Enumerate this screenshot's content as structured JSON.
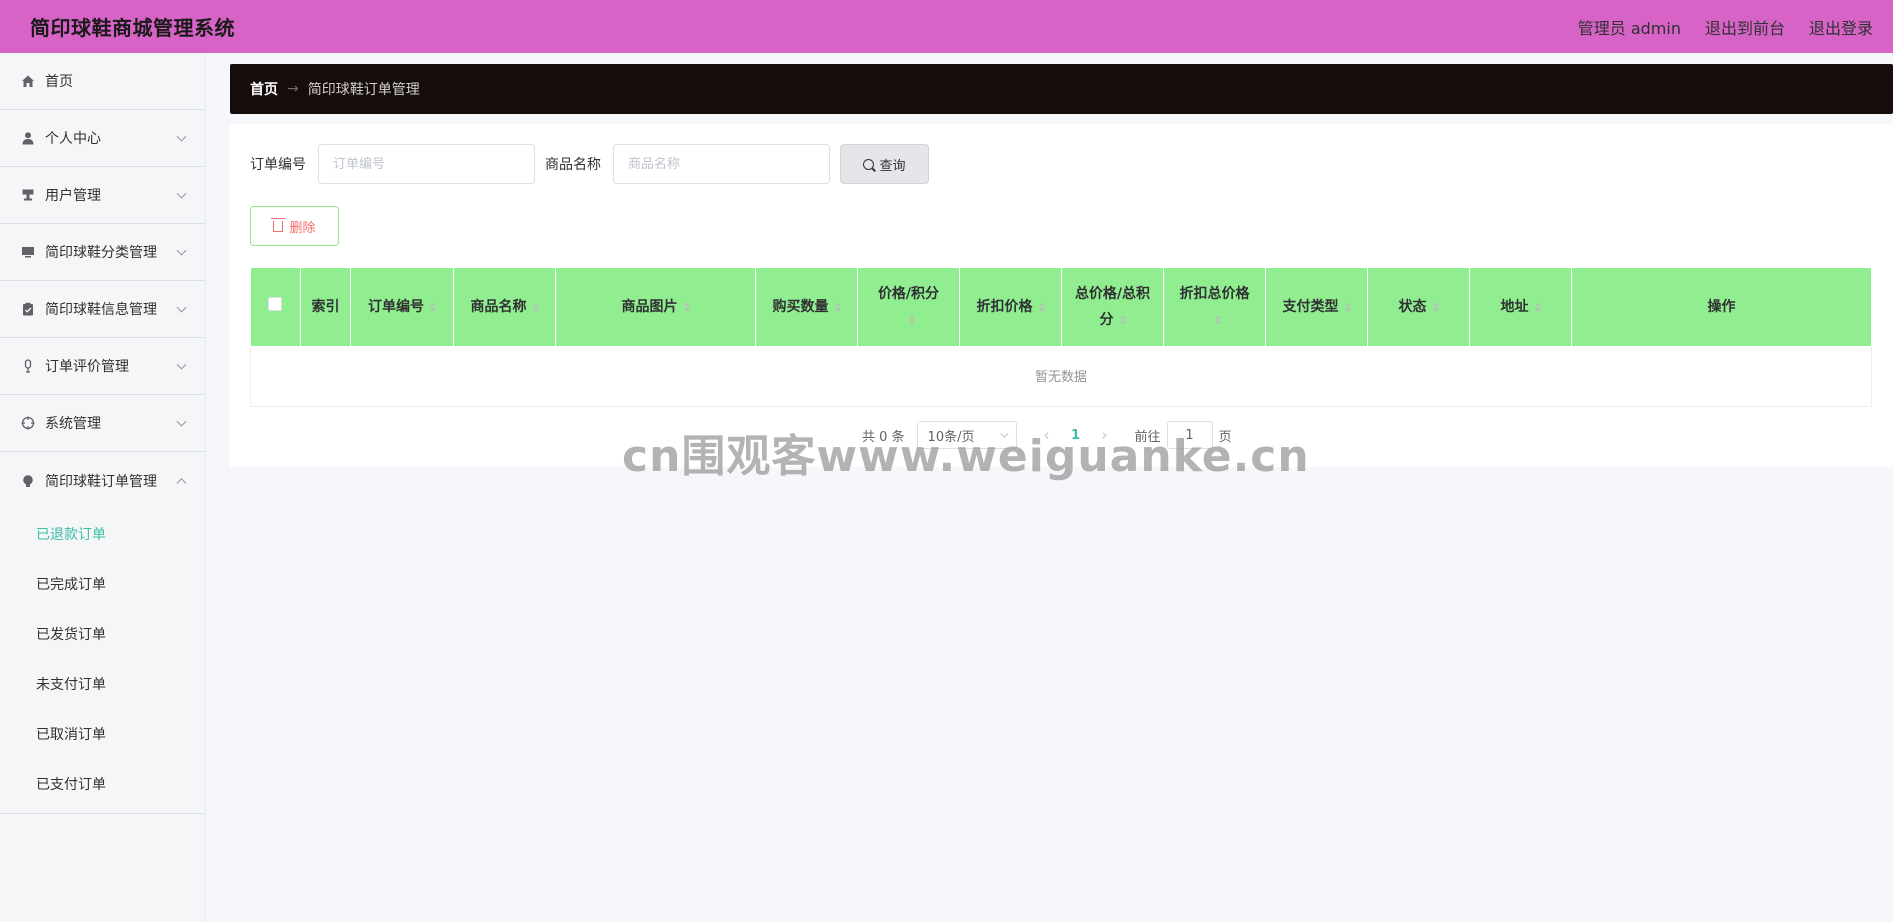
{
  "header": {
    "title": "简印球鞋商城管理系统",
    "admin_label": "管理员 admin",
    "front_label": "退出到前台",
    "logout_label": "退出登录"
  },
  "sidebar": {
    "items": [
      {
        "label": "首页",
        "icon": "home-icon"
      },
      {
        "label": "个人中心",
        "icon": "user-icon"
      },
      {
        "label": "用户管理",
        "icon": "stamp-icon"
      },
      {
        "label": "简印球鞋分类管理",
        "icon": "monitor-icon"
      },
      {
        "label": "简印球鞋信息管理",
        "icon": "clipboard-icon"
      },
      {
        "label": "订单评价管理",
        "icon": "mic-icon"
      },
      {
        "label": "系统管理",
        "icon": "target-icon"
      },
      {
        "label": "简印球鞋订单管理",
        "icon": "bulb-icon"
      }
    ],
    "subitems": [
      "已退款订单",
      "已完成订单",
      "已发货订单",
      "未支付订单",
      "已取消订单",
      "已支付订单"
    ]
  },
  "breadcrumb": {
    "home": "首页",
    "separator": "→",
    "current": "简印球鞋订单管理"
  },
  "search": {
    "order_label": "订单编号",
    "order_placeholder": "订单编号",
    "product_label": "商品名称",
    "product_placeholder": "商品名称",
    "query_label": "查询"
  },
  "actions": {
    "delete_label": "删除"
  },
  "table": {
    "columns": [
      "索引",
      "订单编号",
      "商品名称",
      "商品图片",
      "购买数量",
      "价格/积分",
      "折扣价格",
      "总价格/总积分",
      "折扣总价格",
      "支付类型",
      "状态",
      "地址",
      "操作"
    ],
    "empty_text": "暂无数据"
  },
  "pagination": {
    "total": "共 0 条",
    "page_size": "10条/页",
    "current_page": "1",
    "goto_label": "前往",
    "goto_value": "1",
    "page_suffix": "页"
  },
  "watermark": "cn围观客www.weiguanke.cn",
  "colors": {
    "header_bg": "#d763c7",
    "breadcrumb_bg": "#170c0c",
    "table_header_bg": "#90ee90",
    "accent": "#3bbfa5",
    "danger": "#f56c6c"
  }
}
